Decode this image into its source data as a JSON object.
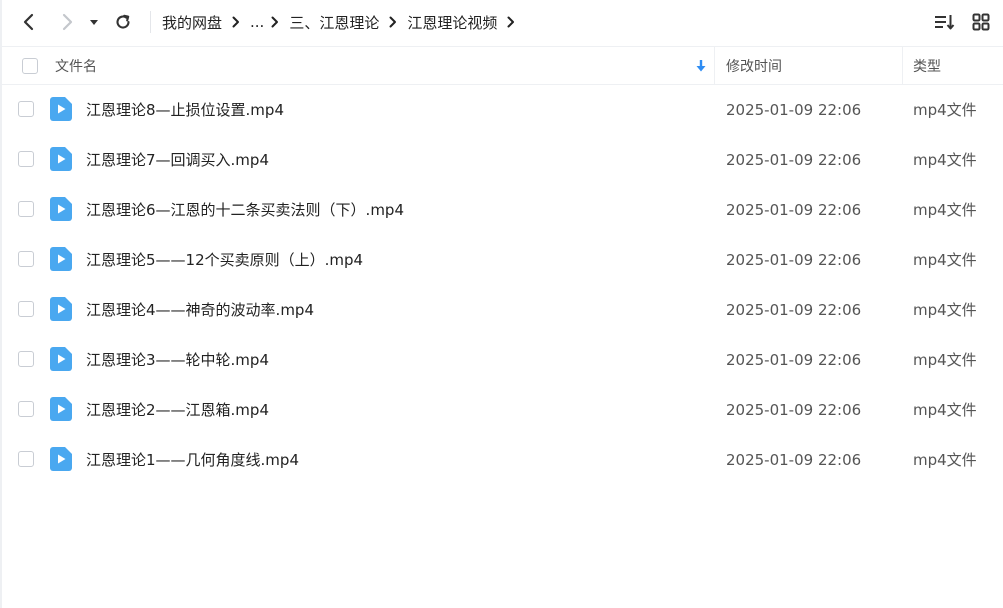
{
  "breadcrumb": {
    "items": [
      "我的网盘",
      "...",
      "三、江恩理论",
      "江恩理论视频"
    ]
  },
  "table": {
    "headers": {
      "name": "文件名",
      "modified": "修改时间",
      "type": "类型"
    },
    "rows": [
      {
        "name": "江恩理论8—止损位设置.mp4",
        "modified": "2025-01-09 22:06",
        "type": "mp4文件"
      },
      {
        "name": "江恩理论7—回调买入.mp4",
        "modified": "2025-01-09 22:06",
        "type": "mp4文件"
      },
      {
        "name": "江恩理论6—江恩的十二条买卖法则（下）.mp4",
        "modified": "2025-01-09 22:06",
        "type": "mp4文件"
      },
      {
        "name": "江恩理论5——12个买卖原则（上）.mp4",
        "modified": "2025-01-09 22:06",
        "type": "mp4文件"
      },
      {
        "name": "江恩理论4——神奇的波动率.mp4",
        "modified": "2025-01-09 22:06",
        "type": "mp4文件"
      },
      {
        "name": "江恩理论3——轮中轮.mp4",
        "modified": "2025-01-09 22:06",
        "type": "mp4文件"
      },
      {
        "name": "江恩理论2——江恩箱.mp4",
        "modified": "2025-01-09 22:06",
        "type": "mp4文件"
      },
      {
        "name": "江恩理论1——几何角度线.mp4",
        "modified": "2025-01-09 22:06",
        "type": "mp4文件"
      }
    ]
  },
  "colors": {
    "video_icon": "#4aa8f0",
    "sort_arrow": "#2f8df3",
    "border": "#eef0f3"
  },
  "icons": {
    "back": "chevron-left-icon",
    "forward": "chevron-right-icon",
    "dropdown": "caret-down-icon",
    "refresh": "refresh-icon",
    "sort": "sort-list-icon",
    "grid": "grid-view-icon",
    "file": "video-file-icon"
  }
}
